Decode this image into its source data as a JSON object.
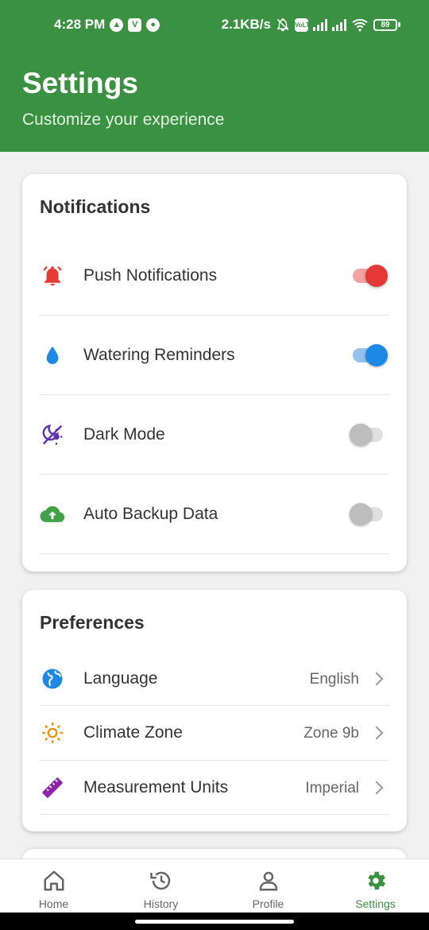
{
  "status_bar": {
    "time": "4:28 PM",
    "speed": "2.1KB/s",
    "battery": "89"
  },
  "header": {
    "title": "Settings",
    "subtitle": "Customize your experience"
  },
  "notifications": {
    "title": "Notifications",
    "items": [
      {
        "label": "Push Notifications",
        "icon": "bell-icon",
        "enabled": true,
        "color": "#e53935"
      },
      {
        "label": "Watering Reminders",
        "icon": "water-drop-icon",
        "enabled": true,
        "color": "#1e88e5"
      },
      {
        "label": "Dark Mode",
        "icon": "theme-light-dark-icon",
        "enabled": false,
        "color": "#5e35b1"
      },
      {
        "label": "Auto Backup Data",
        "icon": "cloud-upload-icon",
        "enabled": false,
        "color": "#43a047"
      }
    ]
  },
  "preferences": {
    "title": "Preferences",
    "items": [
      {
        "label": "Language",
        "value": "English",
        "icon": "globe-icon",
        "color": "#1e88e5"
      },
      {
        "label": "Climate Zone",
        "value": "Zone 9b",
        "icon": "sun-icon",
        "color": "#fb8c00"
      },
      {
        "label": "Measurement Units",
        "value": "Imperial",
        "icon": "ruler-icon",
        "color": "#8e24aa"
      }
    ]
  },
  "bottom_nav": {
    "items": [
      {
        "label": "Home",
        "icon": "home-icon"
      },
      {
        "label": "History",
        "icon": "history-icon"
      },
      {
        "label": "Profile",
        "icon": "person-icon"
      },
      {
        "label": "Settings",
        "icon": "gear-icon",
        "active": true
      }
    ]
  },
  "colors": {
    "primary": "#3b9142",
    "background": "#f1f1f1",
    "toggle_off": "#bdbdbd"
  }
}
